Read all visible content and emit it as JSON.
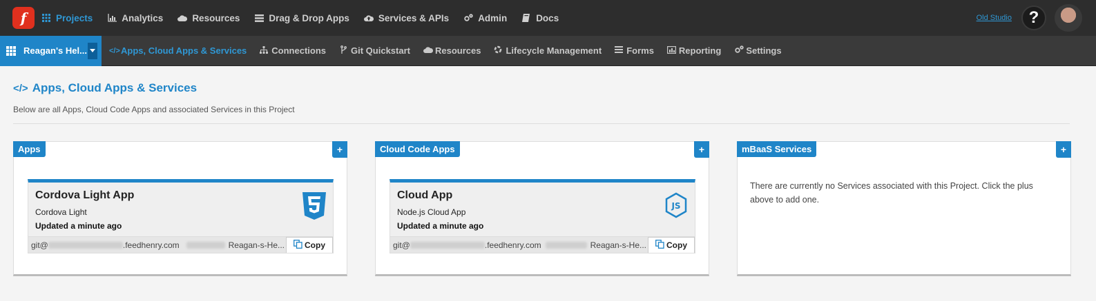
{
  "topbar": {
    "logo_letter": "f",
    "nav": [
      {
        "label": "Projects",
        "icon": "grid-icon",
        "active": true
      },
      {
        "label": "Analytics",
        "icon": "bar-chart-icon",
        "active": false
      },
      {
        "label": "Resources",
        "icon": "cloud-icon",
        "active": false
      },
      {
        "label": "Drag & Drop Apps",
        "icon": "list-icon",
        "active": false
      },
      {
        "label": "Services & APIs",
        "icon": "cloud-upload-icon",
        "active": false
      },
      {
        "label": "Admin",
        "icon": "cogs-icon",
        "active": false
      },
      {
        "label": "Docs",
        "icon": "book-icon",
        "active": false
      }
    ],
    "old_studio": "Old Studio",
    "help": "?"
  },
  "subbar": {
    "project_name": "Reagan's Hel...",
    "nav": [
      {
        "label": "Apps, Cloud Apps & Services",
        "icon": "code-icon",
        "active": true
      },
      {
        "label": "Connections",
        "icon": "sitemap-icon",
        "active": false
      },
      {
        "label": "Git Quickstart",
        "icon": "git-branch-icon",
        "active": false
      },
      {
        "label": "Resources",
        "icon": "cloud-icon",
        "active": false
      },
      {
        "label": "Lifecycle Management",
        "icon": "lifecycle-icon",
        "active": false
      },
      {
        "label": "Forms",
        "icon": "list-icon",
        "active": false
      },
      {
        "label": "Reporting",
        "icon": "bar-chart-icon",
        "active": false
      },
      {
        "label": "Settings",
        "icon": "cogs-icon",
        "active": false
      }
    ]
  },
  "page": {
    "title": "Apps, Cloud Apps & Services",
    "description": "Below are all Apps, Cloud Code Apps and associated Services in this Project"
  },
  "panels": {
    "apps": {
      "title": "Apps",
      "plus": "+",
      "card": {
        "name": "Cordova Light App",
        "type": "Cordova Light",
        "updated": "Updated a minute ago",
        "git_prefix": "git@",
        "git_domain": ".feedhenry.com",
        "git_repo": "Reagan-s-He...",
        "copy_label": "Copy",
        "icon": "html5-icon"
      }
    },
    "cloud": {
      "title": "Cloud Code Apps",
      "plus": "+",
      "card": {
        "name": "Cloud App",
        "type": "Node.js Cloud App",
        "updated": "Updated a minute ago",
        "git_prefix": "git@",
        "git_domain": ".feedhenry.com",
        "git_repo": "Reagan-s-He...",
        "copy_label": "Copy",
        "icon": "nodejs-icon"
      }
    },
    "mbaas": {
      "title": "mBaaS Services",
      "plus": "+",
      "empty_message": "There are currently no Services associated with this Project. Click the plus above to add one."
    }
  },
  "colors": {
    "accent": "#1f85c8",
    "topbar_bg": "#2d2d2d",
    "subbar_bg": "#3a3a3a",
    "logo_red": "#e0301e"
  }
}
